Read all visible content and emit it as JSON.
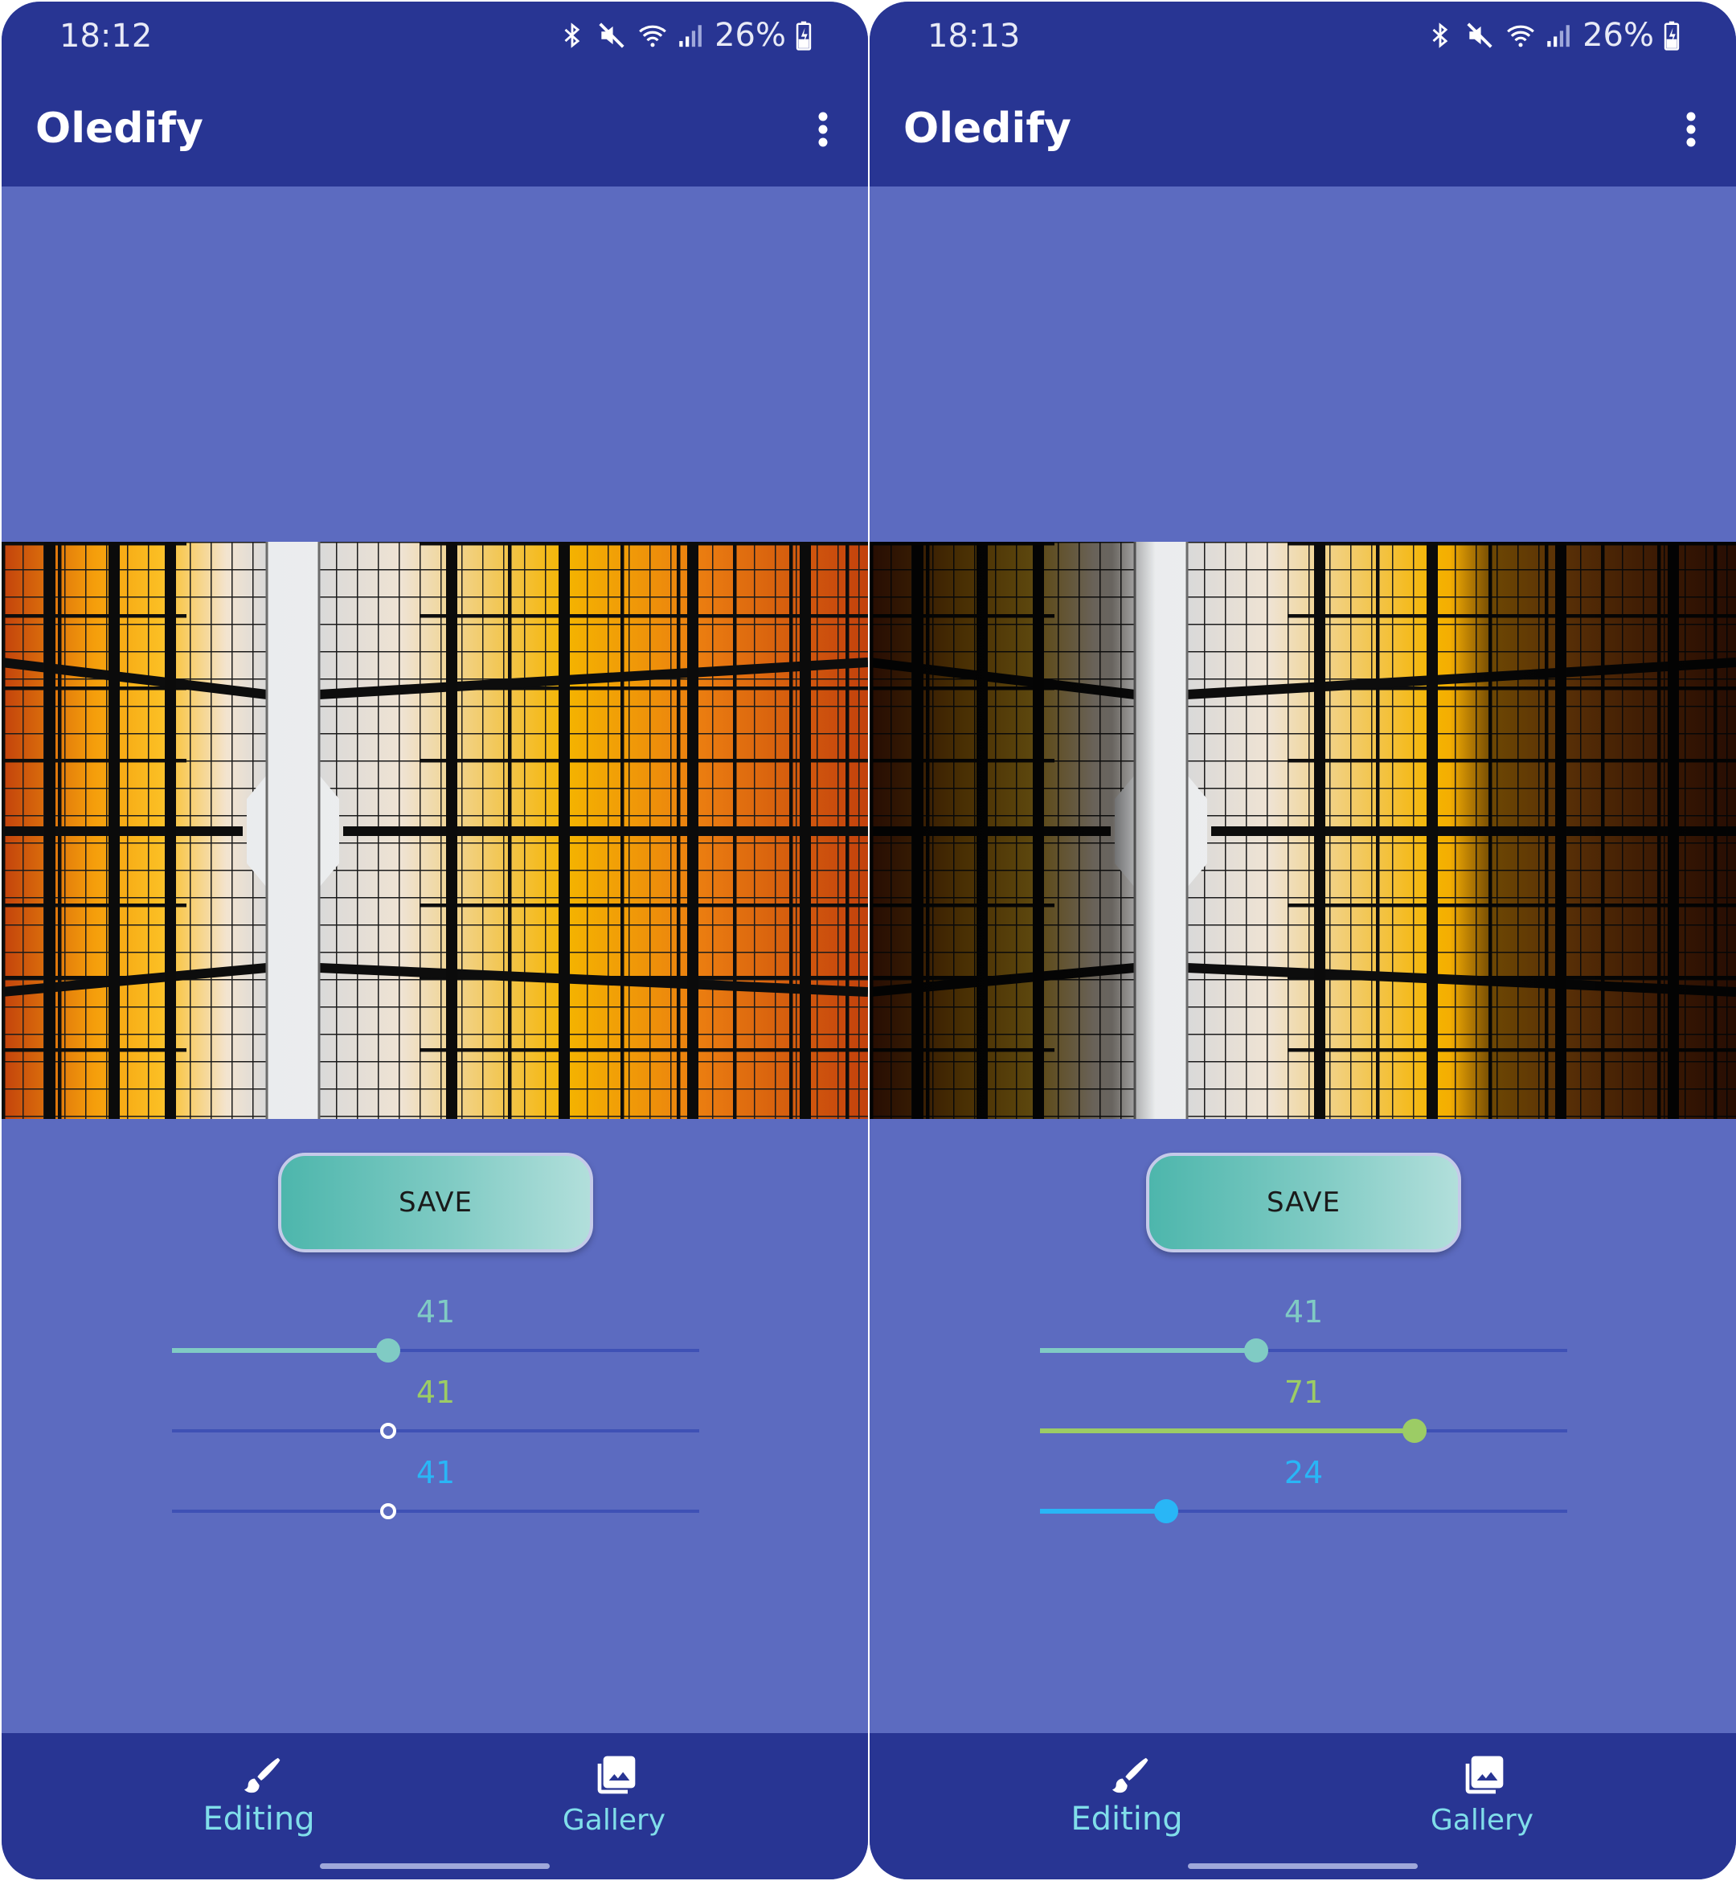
{
  "colors": {
    "app_bar": "#283593",
    "background": "#5c6bc0",
    "slider_1": "#80cbc4",
    "slider_2": "#9ccc65",
    "slider_3": "#29b6f6",
    "nav_label": "#80deea"
  },
  "screens": [
    {
      "status": {
        "time": "18:12",
        "battery": "26%"
      },
      "app_bar": {
        "title": "Oledify",
        "menu_icon": "more-vert-icon"
      },
      "save_button": {
        "label": "SAVE"
      },
      "sliders": [
        {
          "value_label": "41",
          "value": 41,
          "max": 100,
          "active": true
        },
        {
          "value_label": "41",
          "value": 41,
          "max": 100,
          "active": false
        },
        {
          "value_label": "41",
          "value": 41,
          "max": 100,
          "active": false
        }
      ],
      "bottom_nav": [
        {
          "label": "Editing",
          "icon": "brush-icon"
        },
        {
          "label": "Gallery",
          "icon": "photo-library-icon"
        }
      ]
    },
    {
      "status": {
        "time": "18:13",
        "battery": "26%"
      },
      "app_bar": {
        "title": "Oledify",
        "menu_icon": "more-vert-icon"
      },
      "save_button": {
        "label": "SAVE"
      },
      "sliders": [
        {
          "value_label": "41",
          "value": 41,
          "max": 100,
          "active": true
        },
        {
          "value_label": "71",
          "value": 71,
          "max": 100,
          "active": true
        },
        {
          "value_label": "24",
          "value": 24,
          "max": 100,
          "active": true
        }
      ],
      "bottom_nav": [
        {
          "label": "Editing",
          "icon": "brush-icon"
        },
        {
          "label": "Gallery",
          "icon": "photo-library-icon"
        }
      ]
    }
  ]
}
